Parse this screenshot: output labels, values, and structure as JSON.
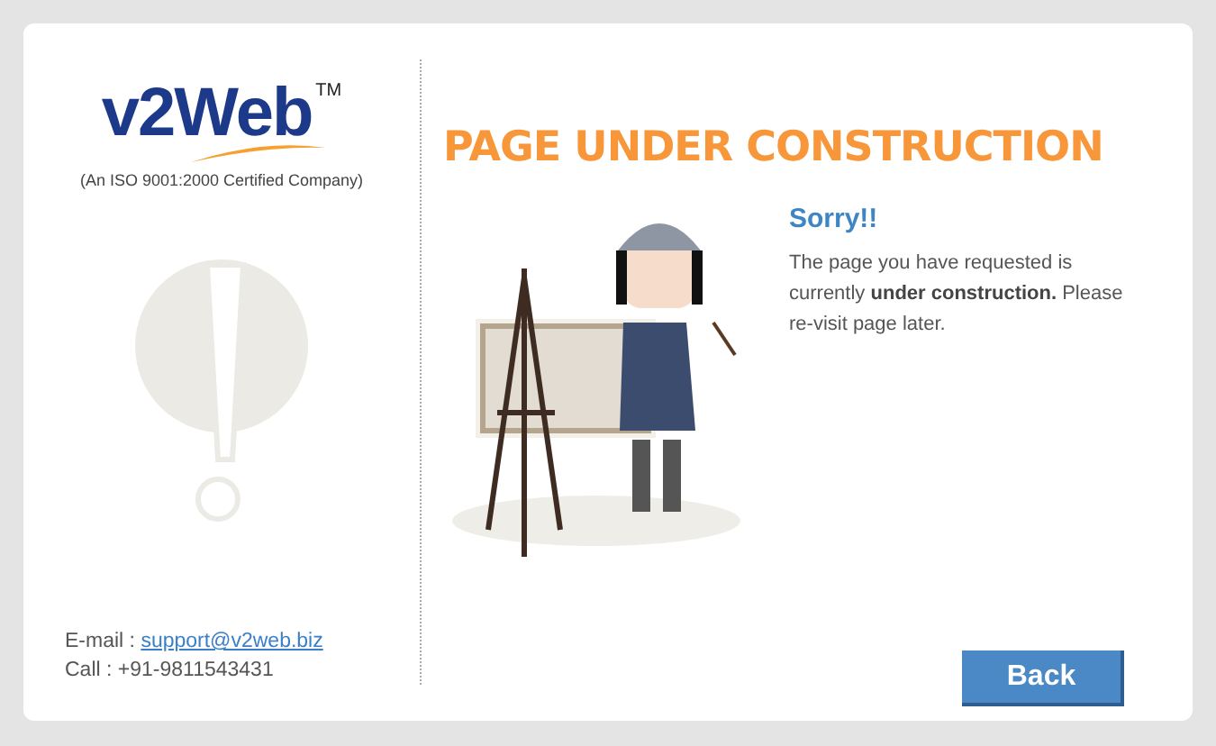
{
  "logo": {
    "text": "v2Web",
    "trademark": "TM",
    "tagline": "(An ISO 9001:2000 Certified Company)"
  },
  "contact": {
    "email_label": "E-mail :",
    "email": "support@v2web.biz",
    "call": "Call : +91-9811543431"
  },
  "headline": "PAGE UNDER CONSTRUCTION",
  "message": {
    "title": "Sorry!!",
    "body": "The page you have requested is currently **under construction.** Please re-visit page later."
  },
  "back_button": "Back"
}
